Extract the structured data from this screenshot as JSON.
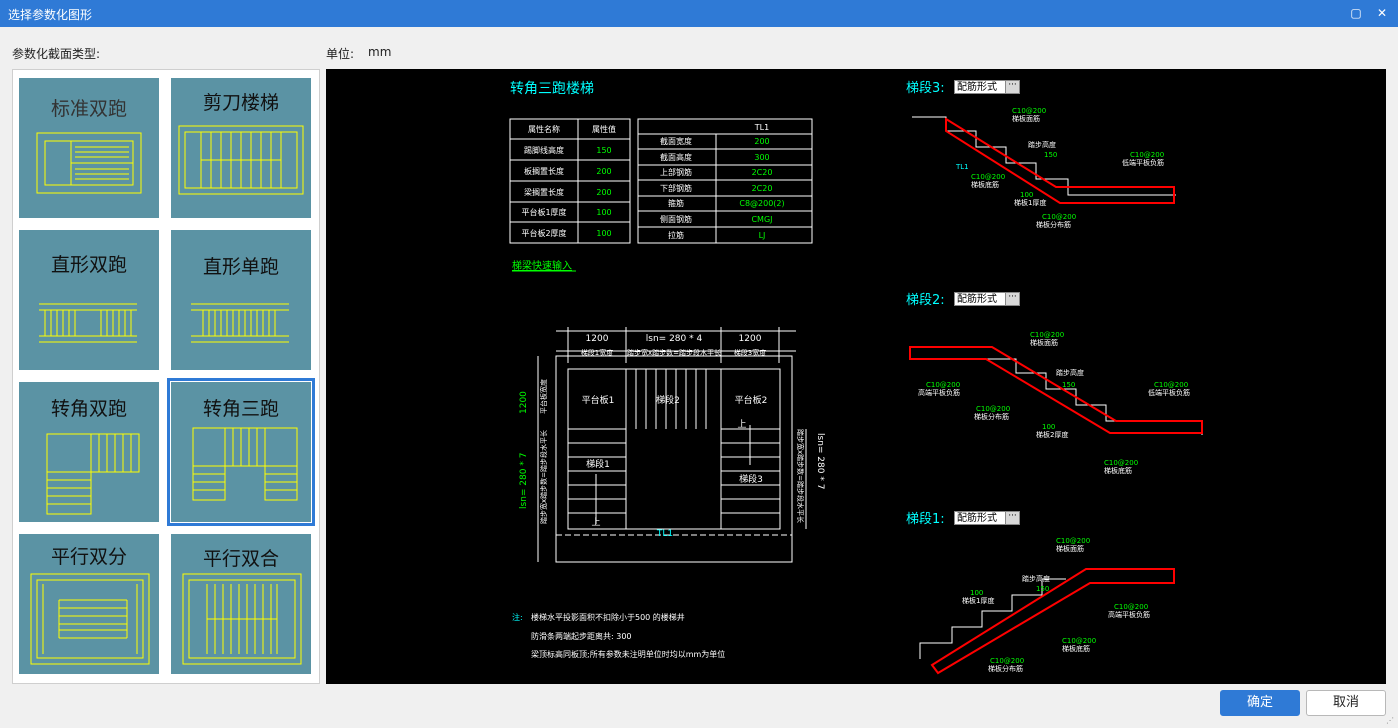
{
  "window": {
    "title": "选择参数化图形",
    "maximize_icon": "maximize-icon",
    "close_icon": "close-icon"
  },
  "left_label": "参数化截面类型:",
  "unit": {
    "label": "单位:",
    "value": "mm"
  },
  "shapes": [
    {
      "label": "标准双跑",
      "selected": false
    },
    {
      "label": "剪刀楼梯",
      "selected": false
    },
    {
      "label": "直形双跑",
      "selected": false
    },
    {
      "label": "直形单跑",
      "selected": false
    },
    {
      "label": "转角双跑",
      "selected": false
    },
    {
      "label": "转角三跑",
      "selected": true
    },
    {
      "label": "平行双分",
      "selected": false
    },
    {
      "label": "平行双合",
      "selected": false
    }
  ],
  "drawing": {
    "title": "转角三跑楼梯",
    "props_table": {
      "headers": [
        "属性名称",
        "属性值"
      ],
      "rows": [
        [
          "踢脚线高度",
          "150"
        ],
        [
          "板搁置长度",
          "200"
        ],
        [
          "梁搁置长度",
          "200"
        ],
        [
          "平台板1厚度",
          "100"
        ],
        [
          "平台板2厚度",
          "100"
        ]
      ]
    },
    "beam_table": {
      "header": "TL1",
      "rows": [
        [
          "截面宽度",
          "200"
        ],
        [
          "截面高度",
          "300"
        ],
        [
          "上部钢筋",
          "2C20"
        ],
        [
          "下部钢筋",
          "2C20"
        ],
        [
          "箍筋",
          "C8@200(2)"
        ],
        [
          "侧面钢筋",
          "CMGJ"
        ],
        [
          "拉筋",
          "LJ"
        ]
      ]
    },
    "quick_input_link": "梯梁快速输入",
    "plan": {
      "dims_top": [
        "1200",
        "lsn= 280 * 4",
        "1200"
      ],
      "dims_top_sub": [
        "梯段1宽度",
        "踏步宽x踏步数=踏步段水平长",
        "梯段3宽度"
      ],
      "left_dim": "1200",
      "left_dim_sub": "平台板宽度",
      "left_run": "lsn= 280 * 7",
      "left_run_sub": "踏步宽x踏步数=踏步段水平长",
      "right_run": "lsn= 280 * 7",
      "right_run_sub": "踏步宽x踏步数=踏步段水平长",
      "labels": [
        "平台板1",
        "梯段2",
        "平台板2",
        "梯段1",
        "梯段3",
        "上",
        "上",
        "TL1"
      ]
    },
    "notes": {
      "prefix": "注:",
      "lines": [
        "楼梯水平投影面积不扣除小于500 的楼梯井",
        "防滑条两端起步距离共: 300",
        "梁顶标高同板顶;所有参数未注明单位时均以mm为单位"
      ]
    },
    "segments": [
      {
        "title": "梯段3:",
        "mode": "配筋形式",
        "labels": [
          "C10@200",
          "梯板面筋",
          "踏步高度",
          "150",
          "TL1",
          "C10@200",
          "梯板底筋",
          "C10@200",
          "低端平板负筋",
          "100",
          "梯板1厚度",
          "C10@200",
          "梯板分布筋"
        ]
      },
      {
        "title": "梯段2:",
        "mode": "配筋形式",
        "labels": [
          "C10@200",
          "梯板面筋",
          "踏步高度",
          "150",
          "C10@200",
          "高端平板负筋",
          "C10@200",
          "低端平板负筋",
          "C10@200",
          "梯板分布筋",
          "100",
          "梯板2厚度",
          "C10@200",
          "梯板底筋"
        ]
      },
      {
        "title": "梯段1:",
        "mode": "配筋形式",
        "labels": [
          "C10@200",
          "梯板面筋",
          "踏步高度",
          "150",
          "100",
          "梯板1厚度",
          "C10@200",
          "高端平板负筋",
          "C10@200",
          "梯板底筋",
          "C10@200",
          "梯板分布筋"
        ]
      }
    ]
  },
  "buttons": {
    "ok": "确定",
    "cancel": "取消"
  },
  "colors": {
    "titlebar": "#2f7ad6",
    "tile": "#5b93a4",
    "cad_yellow": "#ffff00",
    "cad_green": "#00ff00",
    "cad_cyan": "#00ffff",
    "cad_red": "#ff0000"
  }
}
